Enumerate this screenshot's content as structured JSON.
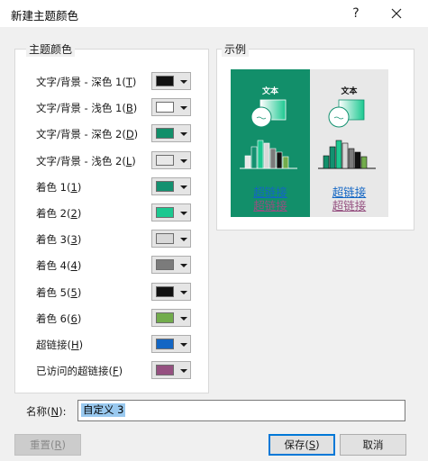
{
  "window": {
    "title": "新建主题颜色",
    "help_label": "?"
  },
  "theme_group": {
    "label": "主题颜色",
    "rows": [
      {
        "text": "文字/背景 - 深色 1",
        "key": "T",
        "color": "#111111"
      },
      {
        "text": "文字/背景 - 浅色 1",
        "key": "B",
        "color": "#ffffff"
      },
      {
        "text": "文字/背景 - 深色 2",
        "key": "D",
        "color": "#128f6a"
      },
      {
        "text": "文字/背景 - 浅色 2",
        "key": "L",
        "color": "#e8e8e8"
      },
      {
        "text": "着色 1",
        "key": "1",
        "color": "#139170"
      },
      {
        "text": "着色 2",
        "key": "2",
        "color": "#1bc890"
      },
      {
        "text": "着色 3",
        "key": "3",
        "color": "#d8d8d8"
      },
      {
        "text": "着色 4",
        "key": "4",
        "color": "#7b7b7b"
      },
      {
        "text": "着色 5",
        "key": "5",
        "color": "#111111"
      },
      {
        "text": "着色 6",
        "key": "6",
        "color": "#72ac4c"
      },
      {
        "text": "超链接",
        "key": "H",
        "color": "#1366c4"
      },
      {
        "text": "已访问的超链接",
        "key": "F",
        "color": "#955080"
      }
    ]
  },
  "sample_group": {
    "label": "示例",
    "panels": [
      {
        "title": "文本",
        "hyperlink": "超链接",
        "visited": "超链接"
      },
      {
        "title": "文本",
        "hyperlink": "超链接",
        "visited": "超链接"
      }
    ]
  },
  "name_field": {
    "label": "名称",
    "key": "N",
    "value": "自定义 3"
  },
  "buttons": {
    "reset": {
      "text": "重置",
      "key": "R"
    },
    "save": {
      "text": "保存",
      "key": "S"
    },
    "cancel": {
      "text": "取消"
    }
  },
  "colors": {
    "dark_panel_bg": "#128f6a",
    "light_panel_bg": "#e8e8e8",
    "accent_focus": "#0078d7"
  }
}
